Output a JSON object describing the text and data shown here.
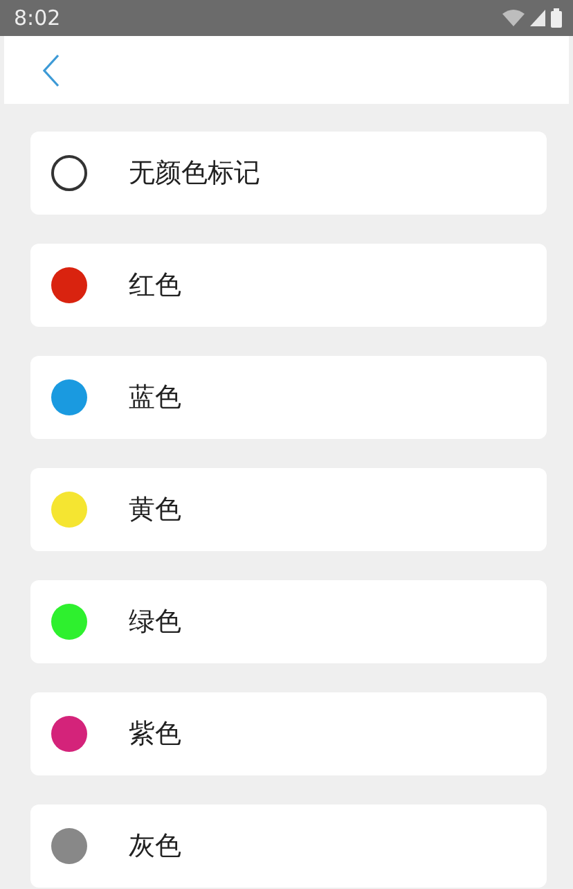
{
  "status_bar": {
    "time": "8:02"
  },
  "colors": [
    {
      "kind": "none",
      "label": "无颜色标记"
    },
    {
      "kind": "color",
      "label": "红色",
      "color": "#d9230f"
    },
    {
      "kind": "color",
      "label": "蓝色",
      "color": "#1a9ae0"
    },
    {
      "kind": "color",
      "label": "黄色",
      "color": "#f5e531"
    },
    {
      "kind": "color",
      "label": "绿色",
      "color": "#2ef02e"
    },
    {
      "kind": "color",
      "label": "紫色",
      "color": "#d4237a"
    },
    {
      "kind": "color",
      "label": "灰色",
      "color": "#888888"
    }
  ]
}
